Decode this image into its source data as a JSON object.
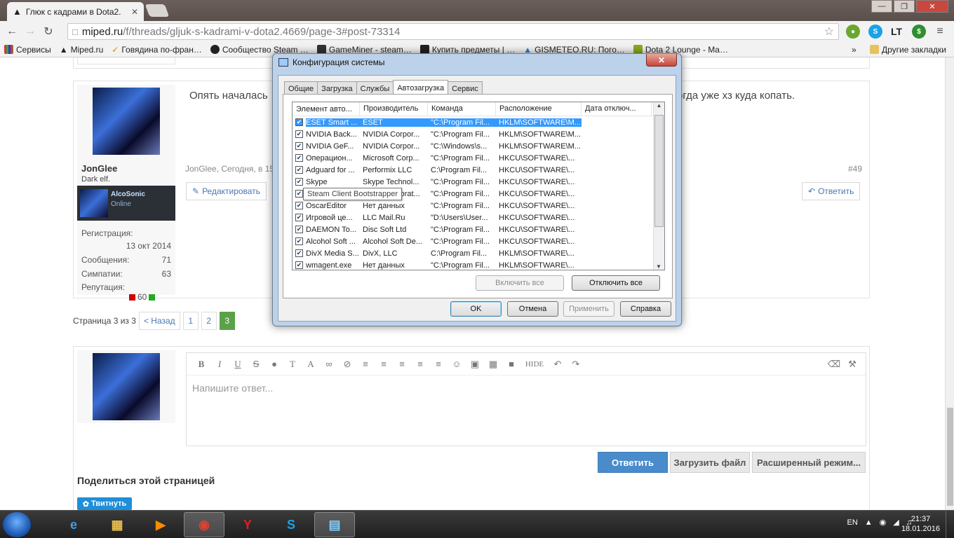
{
  "browser": {
    "tab_title": "Глюк с кадрами в Dota2.",
    "url_host": "miped.ru",
    "url_path": "/f/threads/gljuk-s-kadrami-v-dota2.4669/page-3#post-73314",
    "ext_lt": "LT",
    "bookmarks": [
      "Сервисы",
      "Miped.ru",
      "Говядина по-фран…",
      "Сообщество Steam …",
      "GameMiner - steam…",
      "Купить предметы | …",
      "GISMETEO.RU: Пого…",
      "Dota 2 Lounge - Ma…"
    ],
    "bookmarks_more": "»",
    "other_bookmarks": "Другие закладки"
  },
  "post": {
    "username": "JonGlee",
    "user_title": "Dark elf.",
    "mini_name": "AlcoSonic",
    "mini_status": "Online",
    "reg_label": "Регистрация:",
    "reg_date": "13 окт 2014",
    "msgs_label": "Сообщения:",
    "msgs": "71",
    "likes_label": "Симпатии:",
    "likes": "63",
    "rep_label": "Репутация:",
    "rep": "60",
    "text_start": "Опять началась",
    "text_end": "огда уже хз куда копать.",
    "meta": "JonGlee, Сегодня, в 15",
    "num": "#49",
    "edit": "Редактировать",
    "reply": "Ответить"
  },
  "pager": {
    "label": "Страница 3 из 3",
    "prev": "< Назад",
    "pages": [
      "1",
      "2",
      "3"
    ]
  },
  "reply_box": {
    "placeholder": "Напишите ответ...",
    "hide": "HIDE",
    "submit": "Ответить",
    "upload": "Загрузить файл",
    "advanced": "Расширенный режим..."
  },
  "share": {
    "title": "Поделиться этой страницей",
    "tweet": "Твитнуть"
  },
  "dialog": {
    "title": "Конфигурация системы",
    "tabs": [
      "Общие",
      "Загрузка",
      "Службы",
      "Автозагрузка",
      "Сервис"
    ],
    "columns": [
      "Элемент авто...",
      "Производитель",
      "Команда",
      "Расположение",
      "Дата отключ..."
    ],
    "rows": [
      [
        "ESET Smart ...",
        "ESET",
        "\"C:\\Program Fil...",
        "HKLM\\SOFTWARE\\M...",
        ""
      ],
      [
        "NVIDIA Back...",
        "NVIDIA Corpor...",
        "\"C:\\Program Fil...",
        "HKLM\\SOFTWARE\\M...",
        ""
      ],
      [
        "NVIDIA GeF...",
        "NVIDIA Corpor...",
        "\"C:\\Windows\\s...",
        "HKLM\\SOFTWARE\\M...",
        ""
      ],
      [
        "Операцион...",
        "Microsoft Corp...",
        "\"C:\\Program Fil...",
        "HKCU\\SOFTWARE\\...",
        ""
      ],
      [
        "Adguard for ...",
        "Performix LLC",
        "C:\\Program Fil...",
        "HKCU\\SOFTWARE\\...",
        ""
      ],
      [
        "Skype",
        "Skype Technol...",
        "\"C:\\Program Fil...",
        "HKCU\\SOFTWARE\\...",
        ""
      ],
      [
        "Steam",
        "Valve Corporat...",
        "\"C:\\Program Fil...",
        "HKCU\\SOFTWARE\\...",
        ""
      ],
      [
        "OscarEditor",
        "Нет данных",
        "\"C:\\Program Fil...",
        "HKCU\\SOFTWARE\\...",
        ""
      ],
      [
        "Игровой це...",
        "LLC Mail.Ru",
        "\"D:\\Users\\User...",
        "HKCU\\SOFTWARE\\...",
        ""
      ],
      [
        "DAEMON To...",
        "Disc Soft Ltd",
        "\"C:\\Program Fil...",
        "HKCU\\SOFTWARE\\...",
        ""
      ],
      [
        "Alcohol Soft ...",
        "Alcohol Soft De...",
        "\"C:\\Program Fil...",
        "HKCU\\SOFTWARE\\...",
        ""
      ],
      [
        "DivX Media S...",
        "DivX, LLC",
        "C:\\Program Fil...",
        "HKLM\\SOFTWARE\\...",
        ""
      ],
      [
        "wmagent.exe",
        "Нет данных",
        "\"C:\\Program Fil...",
        "HKLM\\SOFTWARE\\...",
        ""
      ]
    ],
    "tooltip": "Steam Client Bootstrapper",
    "enable_all": "Включить все",
    "disable_all": "Отключить все",
    "ok": "OK",
    "cancel": "Отмена",
    "apply": "Применить",
    "help": "Справка"
  },
  "taskbar": {
    "lang": "EN",
    "time": "21:37",
    "date": "18.01.2016"
  }
}
